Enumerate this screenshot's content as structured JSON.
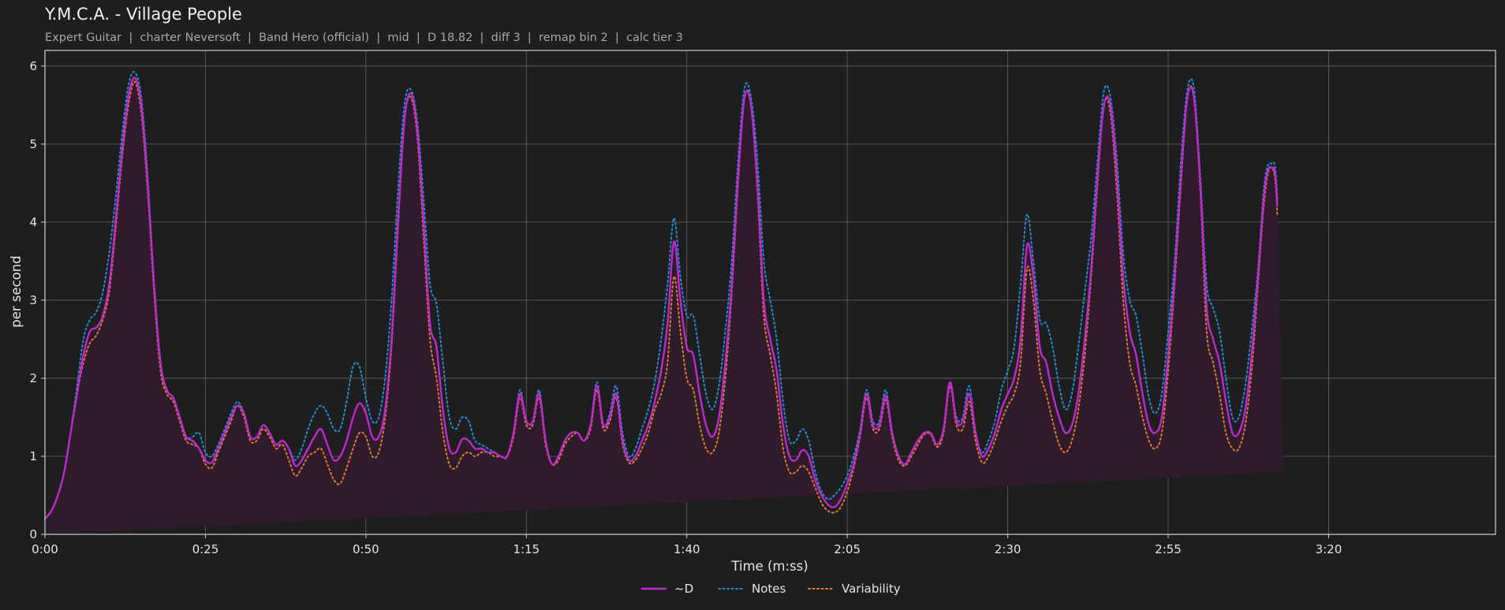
{
  "header": {
    "title": "Y.M.C.A. - Village People",
    "subtitle": "Expert Guitar  |  charter Neversoft  |  Band Hero (official)  |  mid  |  D 18.82  |  diff 3  |  remap bin 2  |  calc tier 3"
  },
  "colors": {
    "background": "#1e1e1e",
    "d": "#c026d3",
    "notes": "#1f8ed8",
    "variability": "#e07b2a",
    "fill": "#2e1c2d",
    "grid": "#666666"
  },
  "chart_data": {
    "type": "line",
    "title": "Y.M.C.A. - Village People",
    "xlabel": "Time (m:ss)",
    "ylabel": "per second",
    "xlim": [
      0,
      226
    ],
    "ylim": [
      0,
      6.2
    ],
    "x_ticks": [
      0,
      25,
      50,
      75,
      100,
      125,
      150,
      175,
      200
    ],
    "x_tick_labels": [
      "0:00",
      "0:25",
      "0:50",
      "1:15",
      "1:40",
      "2:05",
      "2:30",
      "2:55",
      "3:20"
    ],
    "y_ticks": [
      0,
      1,
      2,
      3,
      4,
      5,
      6
    ],
    "y_tick_labels": [
      "0",
      "1",
      "2",
      "3",
      "4",
      "5",
      "6"
    ],
    "grid": true,
    "legend_position": "bottom-center",
    "x": [
      0,
      1,
      2,
      3,
      4,
      5,
      6,
      7,
      8,
      9,
      10,
      11,
      12,
      13,
      14,
      15,
      16,
      17,
      18,
      19,
      20,
      21,
      22,
      23,
      24,
      25,
      26,
      27,
      28,
      29,
      30,
      31,
      32,
      33,
      34,
      35,
      36,
      37,
      38,
      39,
      40,
      41,
      42,
      43,
      44,
      45,
      46,
      47,
      48,
      49,
      50,
      51,
      52,
      53,
      54,
      55,
      56,
      57,
      58,
      59,
      60,
      61,
      62,
      63,
      64,
      65,
      66,
      67,
      68,
      69,
      70,
      71,
      72,
      73,
      74,
      75,
      76,
      77,
      78,
      79,
      80,
      81,
      82,
      83,
      84,
      85,
      86,
      87,
      88,
      89,
      90,
      91,
      92,
      93,
      94,
      95,
      96,
      97,
      98,
      99,
      100,
      101,
      102,
      103,
      104,
      105,
      106,
      107,
      108,
      109,
      110,
      111,
      112,
      113,
      114,
      115,
      116,
      117,
      118,
      119,
      120,
      121,
      122,
      123,
      124,
      125,
      126,
      127,
      128,
      129,
      130,
      131,
      132,
      133,
      134,
      135,
      136,
      137,
      138,
      139,
      140,
      141,
      142,
      143,
      144,
      145,
      146,
      147,
      148,
      149,
      150,
      151,
      152,
      153,
      154,
      155,
      156,
      157,
      158,
      159,
      160,
      161,
      162,
      163,
      164,
      165,
      166,
      167,
      168,
      169,
      170,
      171,
      172,
      173,
      174,
      175,
      176,
      177,
      178,
      179,
      180,
      181,
      182,
      183,
      184,
      185,
      186,
      187,
      188,
      189,
      190,
      191,
      192,
      193,
      194,
      195,
      196,
      197,
      198,
      199,
      200,
      201,
      202,
      203,
      204,
      205,
      206,
      207,
      208,
      209,
      210,
      211,
      212,
      213,
      214,
      215,
      216,
      217,
      218,
      219,
      220,
      221,
      222,
      223,
      224,
      225,
      226
    ],
    "series": [
      {
        "name": "~D",
        "style": "solid",
        "values": [
          0.2,
          0.3,
          0.5,
          0.8,
          1.3,
          1.8,
          2.3,
          2.6,
          2.65,
          2.8,
          3.2,
          4.0,
          4.9,
          5.6,
          5.85,
          5.5,
          4.5,
          3.2,
          2.2,
          1.85,
          1.75,
          1.5,
          1.25,
          1.2,
          1.1,
          0.95,
          0.92,
          1.1,
          1.3,
          1.5,
          1.65,
          1.55,
          1.25,
          1.25,
          1.4,
          1.3,
          1.15,
          1.2,
          1.1,
          0.88,
          0.95,
          1.1,
          1.25,
          1.35,
          1.15,
          0.95,
          1.0,
          1.2,
          1.5,
          1.68,
          1.55,
          1.25,
          1.25,
          1.6,
          2.5,
          4.0,
          5.3,
          5.65,
          5.2,
          4.0,
          2.7,
          2.4,
          1.6,
          1.1,
          1.05,
          1.22,
          1.2,
          1.1,
          1.1,
          1.05,
          1.05,
          1.0,
          1.0,
          1.3,
          1.8,
          1.45,
          1.45,
          1.8,
          1.2,
          0.9,
          1.0,
          1.2,
          1.3,
          1.3,
          1.2,
          1.4,
          1.9,
          1.4,
          1.5,
          1.8,
          1.2,
          0.95,
          1.0,
          1.2,
          1.4,
          1.7,
          2.1,
          2.7,
          3.75,
          3.0,
          2.4,
          2.3,
          1.8,
          1.4,
          1.25,
          1.5,
          2.2,
          3.2,
          4.6,
          5.6,
          5.5,
          4.5,
          3.0,
          2.5,
          2.1,
          1.4,
          1.0,
          0.95,
          1.08,
          1.0,
          0.7,
          0.5,
          0.38,
          0.35,
          0.45,
          0.65,
          0.9,
          1.3,
          1.8,
          1.4,
          1.4,
          1.78,
          1.3,
          1.0,
          0.9,
          1.05,
          1.2,
          1.3,
          1.3,
          1.15,
          1.35,
          1.95,
          1.45,
          1.45,
          1.8,
          1.3,
          1.0,
          1.1,
          1.3,
          1.6,
          1.8,
          2.0,
          2.5,
          3.7,
          3.3,
          2.4,
          2.2,
          1.8,
          1.5,
          1.3,
          1.4,
          1.8,
          2.5,
          3.4,
          4.6,
          5.5,
          5.5,
          4.6,
          3.3,
          2.6,
          2.3,
          1.8,
          1.4,
          1.3,
          1.5,
          2.3,
          3.3,
          4.6,
          5.6,
          5.6,
          4.5,
          2.9,
          2.5,
          2.2,
          1.7,
          1.3,
          1.3,
          1.6,
          2.3,
          3.3,
          4.4,
          4.7,
          4.2,
          0.8
        ]
      },
      {
        "name": "Notes",
        "style": "dotted",
        "values": [
          0.2,
          0.3,
          0.5,
          0.8,
          1.3,
          1.9,
          2.5,
          2.75,
          2.85,
          3.1,
          3.6,
          4.3,
          5.1,
          5.75,
          5.92,
          5.6,
          4.6,
          3.2,
          2.2,
          1.85,
          1.75,
          1.5,
          1.25,
          1.25,
          1.3,
          1.05,
          1.0,
          1.15,
          1.35,
          1.55,
          1.7,
          1.55,
          1.25,
          1.25,
          1.4,
          1.3,
          1.15,
          1.2,
          1.1,
          0.95,
          1.1,
          1.35,
          1.55,
          1.65,
          1.55,
          1.35,
          1.35,
          1.7,
          2.15,
          2.15,
          1.75,
          1.45,
          1.5,
          2.0,
          3.0,
          4.4,
          5.5,
          5.7,
          5.3,
          4.3,
          3.2,
          2.95,
          2.2,
          1.5,
          1.35,
          1.5,
          1.45,
          1.2,
          1.15,
          1.1,
          1.05,
          1.0,
          1.0,
          1.3,
          1.85,
          1.45,
          1.45,
          1.85,
          1.2,
          0.9,
          1.0,
          1.2,
          1.3,
          1.3,
          1.2,
          1.4,
          1.95,
          1.4,
          1.55,
          1.9,
          1.3,
          1.0,
          1.1,
          1.35,
          1.6,
          1.95,
          2.5,
          3.2,
          4.05,
          3.3,
          2.8,
          2.8,
          2.3,
          1.8,
          1.6,
          1.9,
          2.6,
          3.5,
          4.8,
          5.72,
          5.6,
          4.8,
          3.5,
          3.0,
          2.5,
          1.7,
          1.2,
          1.2,
          1.35,
          1.2,
          0.8,
          0.55,
          0.45,
          0.5,
          0.6,
          0.75,
          1.0,
          1.35,
          1.85,
          1.45,
          1.45,
          1.85,
          1.3,
          1.0,
          0.9,
          1.05,
          1.2,
          1.3,
          1.3,
          1.15,
          1.35,
          1.95,
          1.5,
          1.5,
          1.9,
          1.3,
          1.05,
          1.2,
          1.45,
          1.85,
          2.1,
          2.4,
          3.2,
          4.1,
          3.5,
          2.75,
          2.7,
          2.4,
          1.9,
          1.6,
          1.8,
          2.4,
          3.1,
          3.8,
          4.8,
          5.68,
          5.6,
          4.8,
          3.6,
          3.0,
          2.8,
          2.3,
          1.75,
          1.55,
          1.8,
          2.6,
          3.5,
          4.8,
          5.7,
          5.72,
          4.6,
          3.2,
          2.9,
          2.6,
          2.0,
          1.5,
          1.5,
          1.9,
          2.6,
          3.4,
          4.5,
          4.75,
          4.3,
          0.8
        ]
      },
      {
        "name": "Variability",
        "style": "dotted",
        "values": [
          0.2,
          0.3,
          0.5,
          0.8,
          1.3,
          1.8,
          2.2,
          2.45,
          2.55,
          2.75,
          3.1,
          3.9,
          4.8,
          5.5,
          5.8,
          5.4,
          4.4,
          3.1,
          2.1,
          1.8,
          1.7,
          1.45,
          1.2,
          1.15,
          1.1,
          0.9,
          0.85,
          1.05,
          1.25,
          1.45,
          1.65,
          1.5,
          1.2,
          1.2,
          1.35,
          1.25,
          1.1,
          1.15,
          0.95,
          0.75,
          0.85,
          1.0,
          1.05,
          1.1,
          0.9,
          0.7,
          0.65,
          0.85,
          1.1,
          1.3,
          1.25,
          1.0,
          1.05,
          1.5,
          2.4,
          3.9,
          5.3,
          5.6,
          5.1,
          3.8,
          2.5,
          2.0,
          1.3,
          0.9,
          0.85,
          1.0,
          1.05,
          1.0,
          1.05,
          1.05,
          1.0,
          1.0,
          1.0,
          1.25,
          1.75,
          1.4,
          1.4,
          1.75,
          1.15,
          0.9,
          0.95,
          1.15,
          1.25,
          1.3,
          1.2,
          1.35,
          1.85,
          1.35,
          1.45,
          1.75,
          1.15,
          0.92,
          0.95,
          1.1,
          1.3,
          1.6,
          1.8,
          2.2,
          3.3,
          2.6,
          2.0,
          1.85,
          1.4,
          1.1,
          1.05,
          1.3,
          2.0,
          3.1,
          4.5,
          5.6,
          5.5,
          4.4,
          2.8,
          2.3,
          1.8,
          1.1,
          0.8,
          0.8,
          0.88,
          0.8,
          0.6,
          0.4,
          0.3,
          0.28,
          0.35,
          0.55,
          0.85,
          1.25,
          1.75,
          1.35,
          1.35,
          1.72,
          1.25,
          0.95,
          0.88,
          1.0,
          1.15,
          1.28,
          1.28,
          1.12,
          1.3,
          1.9,
          1.4,
          1.35,
          1.7,
          1.2,
          0.92,
          1.0,
          1.2,
          1.45,
          1.65,
          1.8,
          2.2,
          3.4,
          3.0,
          2.1,
          1.8,
          1.45,
          1.15,
          1.05,
          1.2,
          1.6,
          2.3,
          3.3,
          4.5,
          5.5,
          5.4,
          4.4,
          3.0,
          2.2,
          1.9,
          1.5,
          1.2,
          1.1,
          1.3,
          2.1,
          3.2,
          4.5,
          5.6,
          5.6,
          4.4,
          2.6,
          2.2,
          1.8,
          1.3,
          1.1,
          1.1,
          1.4,
          2.1,
          3.2,
          4.3,
          4.7,
          4.1,
          0.8
        ]
      }
    ]
  }
}
